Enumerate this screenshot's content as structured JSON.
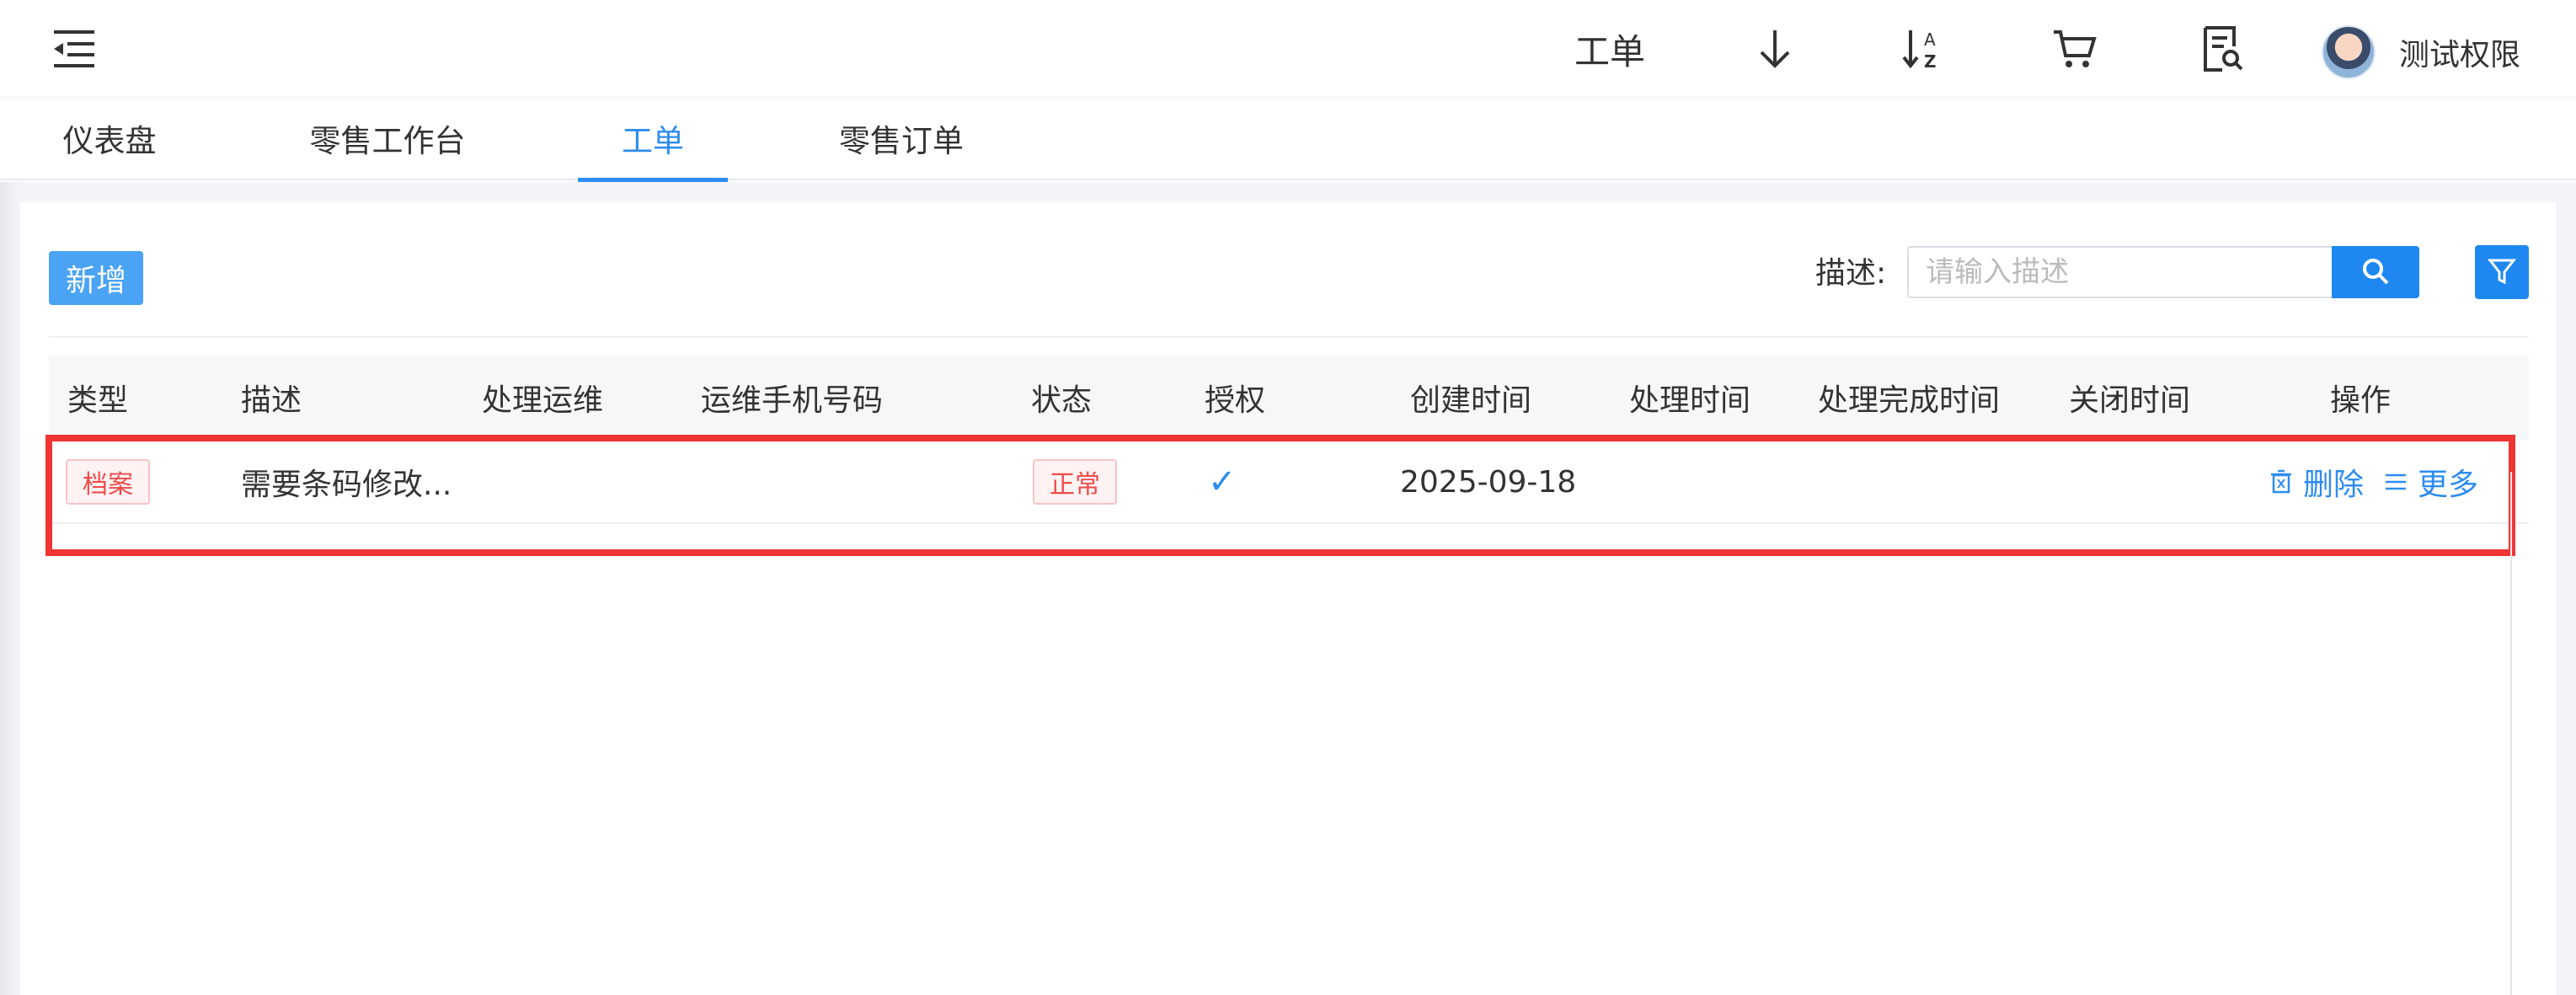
{
  "header": {
    "title": "工单",
    "icons": [
      "menu-fold-icon",
      "arrow-down-icon",
      "sort-az-icon",
      "cart-icon",
      "report-search-icon"
    ],
    "user": {
      "name": "测试权限",
      "avatar": "avatar"
    }
  },
  "tabs": [
    {
      "label": "仪表盘",
      "active": false
    },
    {
      "label": "零售工作台",
      "active": false
    },
    {
      "label": "工单",
      "active": true
    },
    {
      "label": "零售订单",
      "active": false
    }
  ],
  "toolbar": {
    "add_label": "新增",
    "desc_label": "描述:",
    "desc_placeholder": "请输入描述",
    "search_icon": "search-icon",
    "filter_icon": "filter-icon"
  },
  "table": {
    "columns": [
      "类型",
      "描述",
      "处理运维",
      "运维手机号码",
      "状态",
      "授权",
      "创建时间",
      "处理时间",
      "处理完成时间",
      "关闭时间",
      "操作"
    ],
    "rows": [
      {
        "type": "档案",
        "description": "需要条码修改...",
        "handler": "",
        "handler_phone": "",
        "status": "正常",
        "authorized": "✓",
        "created": "2025-09-18",
        "processed": "",
        "completed": "",
        "closed": "",
        "actions": {
          "delete": "删除",
          "more": "更多"
        }
      }
    ]
  },
  "colors": {
    "accent": "#2d8cf0",
    "button": "#4aa3f5",
    "highlight": "#ef3434",
    "tag_red": "#ef4b4b"
  }
}
